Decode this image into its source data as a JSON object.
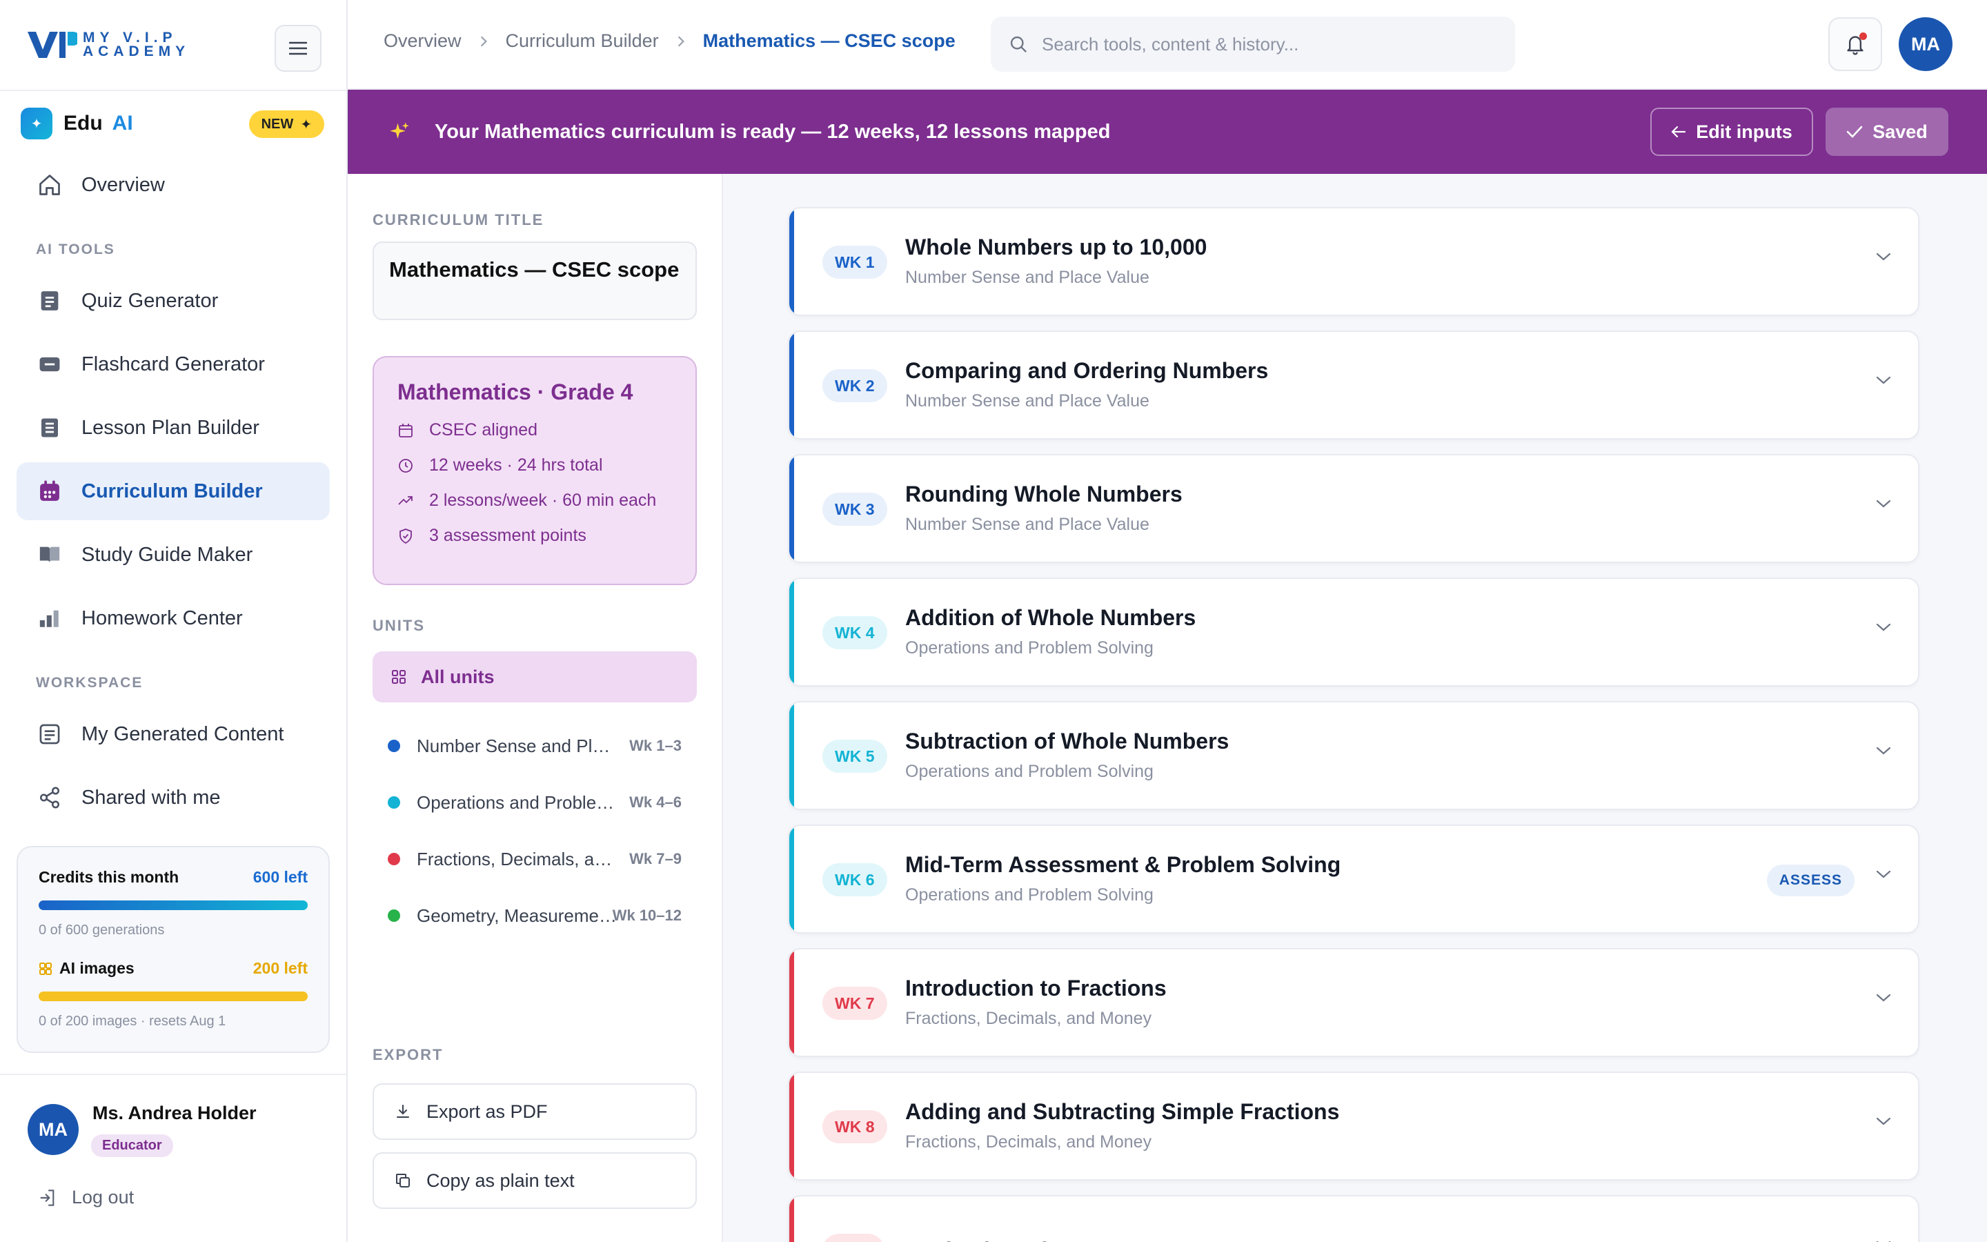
{
  "brand": {
    "line1": "MY V.I.P",
    "line2": "ACADEMY"
  },
  "eduai": {
    "name": "Edu",
    "ai": "AI",
    "badge": "NEW"
  },
  "nav": {
    "overview": "Overview",
    "ai_tools_label": "AI TOOLS",
    "tools": [
      "Quiz Generator",
      "Flashcard Generator",
      "Lesson Plan Builder",
      "Curriculum Builder",
      "Study Guide Maker",
      "Homework Center"
    ],
    "workspace_label": "WORKSPACE",
    "workspace": [
      "My Generated Content",
      "Shared with me"
    ]
  },
  "credits": {
    "title": "Credits this month",
    "left": "600 left",
    "sub": "0 of 600 generations",
    "images_title": "AI images",
    "images_left": "200 left",
    "images_sub": "0 of 200 images · resets Aug 1"
  },
  "user": {
    "initials": "MA",
    "name": "Ms. Andrea Holder",
    "role": "Educator",
    "logout": "Log out"
  },
  "breadcrumb": [
    "Overview",
    "Curriculum Builder",
    "Mathematics — CSEC scope"
  ],
  "search": {
    "placeholder": "Search tools, content & history..."
  },
  "banner": {
    "message": "Your Mathematics curriculum is ready — 12 weeks, 12 lessons mapped",
    "edit": "Edit inputs",
    "saved": "Saved"
  },
  "panel": {
    "title_label": "CURRICULUM TITLE",
    "title": "Mathematics — CSEC scope",
    "grade_title": "Mathematics · Grade 4",
    "grade_rows": [
      "CSEC aligned",
      "12 weeks · 24 hrs total",
      "2 lessons/week · 60 min each",
      "3 assessment points"
    ],
    "units_label": "UNITS",
    "all_units": "All units",
    "units": [
      {
        "name": "Number Sense and Place Value",
        "weeks": "Wk 1–3",
        "color": "#1a62c8"
      },
      {
        "name": "Operations and Problem Solving",
        "weeks": "Wk 4–6",
        "color": "#12b3d4"
      },
      {
        "name": "Fractions, Decimals, and Money",
        "weeks": "Wk 7–9",
        "color": "#e03a4a"
      },
      {
        "name": "Geometry, Measurement and Data",
        "weeks": "Wk 10–12",
        "color": "#27b24a"
      }
    ],
    "export_label": "EXPORT",
    "export_pdf": "Export as PDF",
    "copy_text": "Copy as plain text"
  },
  "weeks": [
    {
      "badge": "WK 1",
      "title": "Whole Numbers up to 10,000",
      "unit": "Number Sense and Place Value",
      "color": "#1a62c8",
      "bg": "#e8f0fb"
    },
    {
      "badge": "WK 2",
      "title": "Comparing and Ordering Numbers",
      "unit": "Number Sense and Place Value",
      "color": "#1a62c8",
      "bg": "#e8f0fb"
    },
    {
      "badge": "WK 3",
      "title": "Rounding Whole Numbers",
      "unit": "Number Sense and Place Value",
      "color": "#1a62c8",
      "bg": "#e8f0fb"
    },
    {
      "badge": "WK 4",
      "title": "Addition of Whole Numbers",
      "unit": "Operations and Problem Solving",
      "color": "#12b3d4",
      "bg": "#e0f6fa"
    },
    {
      "badge": "WK 5",
      "title": "Subtraction of Whole Numbers",
      "unit": "Operations and Problem Solving",
      "color": "#12b3d4",
      "bg": "#e0f6fa"
    },
    {
      "badge": "WK 6",
      "title": "Mid-Term Assessment & Problem Solving",
      "unit": "Operations and Problem Solving",
      "color": "#12b3d4",
      "bg": "#e0f6fa",
      "tag": "ASSESS"
    },
    {
      "badge": "WK 7",
      "title": "Introduction to Fractions",
      "unit": "Fractions, Decimals, and Money",
      "color": "#e03a4a",
      "bg": "#fde6e8"
    },
    {
      "badge": "WK 8",
      "title": "Adding and Subtracting Simple Fractions",
      "unit": "Fractions, Decimals, and Money",
      "color": "#e03a4a",
      "bg": "#fde6e8"
    },
    {
      "badge": "",
      "title": "Decimals and Money",
      "unit": "",
      "color": "#e03a4a",
      "bg": "#fde6e8"
    }
  ]
}
